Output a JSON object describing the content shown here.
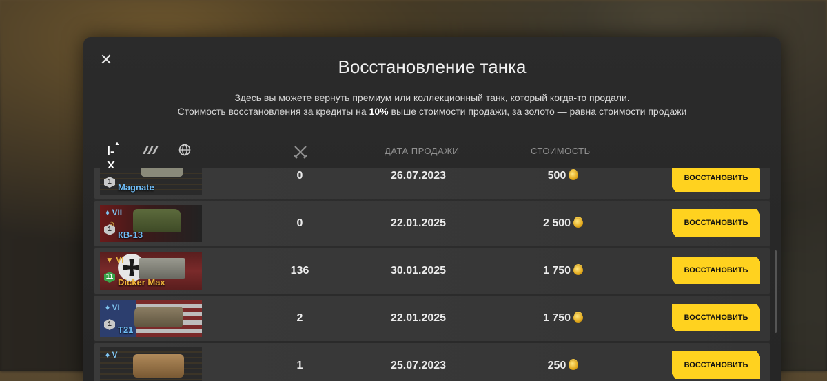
{
  "modal": {
    "title": "Восстановление танка",
    "desc_line1": "Здесь вы можете вернуть премиум или коллекционный танк, который когда-то продали.",
    "desc_line2_pre": "Стоимость восстановления за кредиты на ",
    "desc_line2_bold": "10%",
    "desc_line2_post": " выше стоимости продажи, за золото — равна стоимости продажи",
    "close_icon": "close-icon"
  },
  "filters": {
    "tier_label": "I-X",
    "nation_icon": "nation-filter-icon",
    "globe_icon": "globe-icon"
  },
  "columns": {
    "battles_icon": "crossed-swords-icon",
    "date": "ДАТА ПРОДАЖИ",
    "price": "СТОИМОСТЬ"
  },
  "rows": [
    {
      "tier": "",
      "name": "Magnate",
      "mastery": "1",
      "battles": "0",
      "date": "26.07.2023",
      "price": "500",
      "restore": "ВОССТАНОВИТЬ",
      "premium": false
    },
    {
      "tier": "VII",
      "name": "КВ-13",
      "mastery": "1",
      "battles": "0",
      "date": "22.01.2025",
      "price": "2 500",
      "restore": "ВОССТАНОВИТЬ",
      "premium": false
    },
    {
      "tier": "VI",
      "name": "Dicker Max",
      "mastery": "11",
      "battles": "136",
      "date": "30.01.2025",
      "price": "1 750",
      "restore": "ВОССТАНОВИТЬ",
      "premium": true
    },
    {
      "tier": "VI",
      "name": "T21",
      "mastery": "1",
      "battles": "2",
      "date": "22.01.2025",
      "price": "1 750",
      "restore": "ВОССТАНОВИТЬ",
      "premium": false
    },
    {
      "tier": "V",
      "name": "",
      "mastery": "",
      "battles": "1",
      "date": "25.07.2023",
      "price": "250",
      "restore": "ВОССТАНОВИТЬ",
      "premium": false
    }
  ],
  "colors": {
    "accent_button": "#ffd21f",
    "premium_name": "#f0b43a",
    "regular_name": "#6fbcf5"
  }
}
